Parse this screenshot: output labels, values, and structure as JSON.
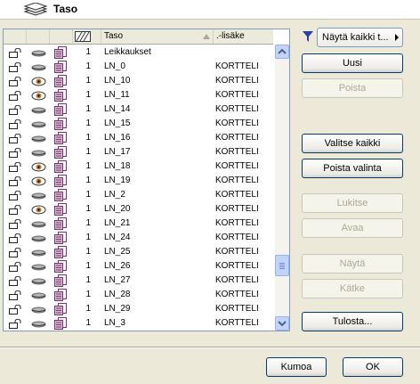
{
  "dialog": {
    "title": "Taso"
  },
  "list": {
    "headers": {
      "name": "Taso",
      "suffix": ".-lisäke"
    },
    "rows": [
      {
        "num": "1",
        "name": "Leikkaukset",
        "suffix": "",
        "eye": "closed"
      },
      {
        "num": "1",
        "name": "LN_0",
        "suffix": "KORTTELI",
        "eye": "closed"
      },
      {
        "num": "1",
        "name": "LN_10",
        "suffix": "KORTTELI",
        "eye": "open"
      },
      {
        "num": "1",
        "name": "LN_11",
        "suffix": "KORTTELI",
        "eye": "open"
      },
      {
        "num": "1",
        "name": "LN_14",
        "suffix": "KORTTELI",
        "eye": "closed"
      },
      {
        "num": "1",
        "name": "LN_15",
        "suffix": "KORTTELI",
        "eye": "closed"
      },
      {
        "num": "1",
        "name": "LN_16",
        "suffix": "KORTTELI",
        "eye": "closed"
      },
      {
        "num": "1",
        "name": "LN_17",
        "suffix": "KORTTELI",
        "eye": "closed"
      },
      {
        "num": "1",
        "name": "LN_18",
        "suffix": "KORTTELI",
        "eye": "open"
      },
      {
        "num": "1",
        "name": "LN_19",
        "suffix": "KORTTELI",
        "eye": "open"
      },
      {
        "num": "1",
        "name": "LN_2",
        "suffix": "KORTTELI",
        "eye": "closed"
      },
      {
        "num": "1",
        "name": "LN_20",
        "suffix": "KORTTELI",
        "eye": "open"
      },
      {
        "num": "1",
        "name": "LN_21",
        "suffix": "KORTTELI",
        "eye": "closed"
      },
      {
        "num": "1",
        "name": "LN_24",
        "suffix": "KORTTELI",
        "eye": "closed"
      },
      {
        "num": "1",
        "name": "LN_25",
        "suffix": "KORTTELI",
        "eye": "closed"
      },
      {
        "num": "1",
        "name": "LN_26",
        "suffix": "KORTTELI",
        "eye": "closed"
      },
      {
        "num": "1",
        "name": "LN_27",
        "suffix": "KORTTELI",
        "eye": "closed"
      },
      {
        "num": "1",
        "name": "LN_28",
        "suffix": "KORTTELI",
        "eye": "closed"
      },
      {
        "num": "1",
        "name": "LN_29",
        "suffix": "KORTTELI",
        "eye": "closed"
      },
      {
        "num": "1",
        "name": "LN_3",
        "suffix": "KORTTELI",
        "eye": "closed"
      }
    ]
  },
  "filter": {
    "selected": "Näytä kaikki t..."
  },
  "buttons": {
    "uusi": "Uusi",
    "poista": "Poista",
    "valitse_kaikki": "Valitse kaikki",
    "poista_valinta": "Poista valinta",
    "lukitse": "Lukitse",
    "avaa": "Avaa",
    "nayta": "Näytä",
    "katke": "Kätke",
    "tulosta": "Tulosta...",
    "kumoa": "Kumoa",
    "ok": "OK"
  },
  "colors": {
    "accent": "#003c74",
    "eye_open": "#c8782a",
    "layer_icon": "#7a2f6e"
  }
}
